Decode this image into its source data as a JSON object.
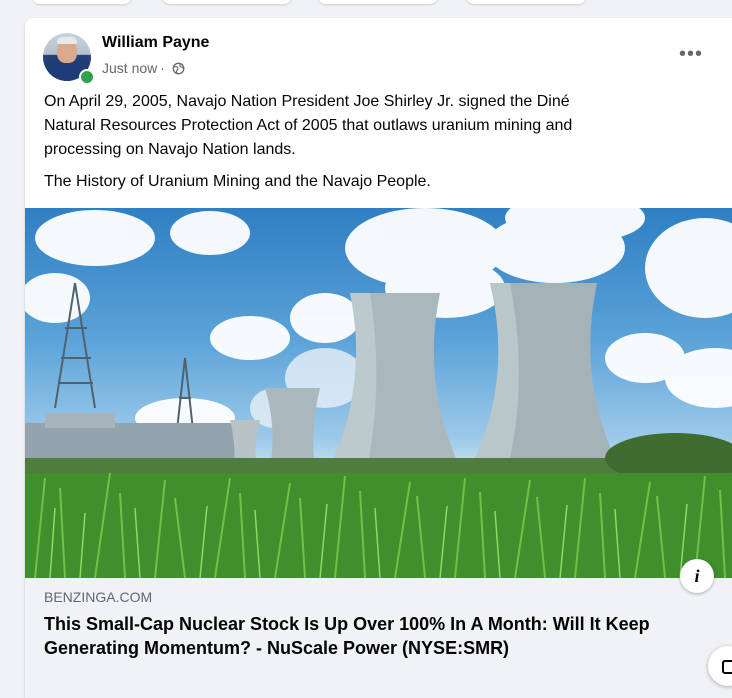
{
  "post": {
    "author": "William Payne",
    "time": "Just now",
    "separator": "·",
    "privacy_icon": "globe-icon",
    "more_icon": "more-options-icon",
    "more_label": "•••",
    "text_paragraphs": [
      "On April 29, 2005, Navajo Nation President Joe Shirley Jr. signed the Diné Natural Resources Protection Act of 2005 that outlaws uranium mining and processing on Navajo Nation lands.",
      "The History of Uranium Mining and the Navajo People."
    ]
  },
  "link_preview": {
    "domain": "BENZINGA.COM",
    "title": "This Small-Cap Nuclear Stock Is Up Over 100% In A Month: Will It Keep Generating Momentum? - NuScale Power (NYSE:SMR)",
    "info_label": "i",
    "image_icon": "nuclear-cooling-towers-image"
  },
  "colors": {
    "online": "#31a24c",
    "secondary_text": "#65676b",
    "primary_text": "#050505",
    "footer_bg": "#f0f2f5"
  }
}
